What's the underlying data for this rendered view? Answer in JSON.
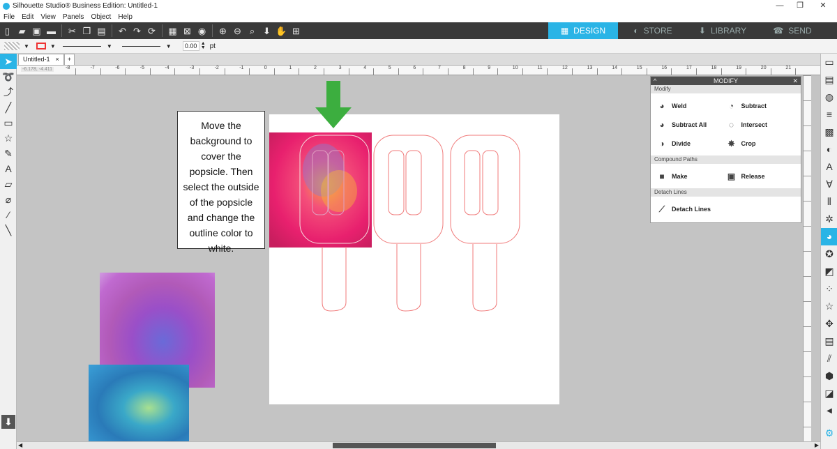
{
  "window": {
    "title": "Silhouette Studio® Business Edition: Untitled-1",
    "minimize": "—",
    "restore": "❐",
    "close": "✕"
  },
  "menu": [
    "File",
    "Edit",
    "View",
    "Panels",
    "Object",
    "Help"
  ],
  "main_tabs": [
    {
      "label": "DESIGN",
      "icon": "▦",
      "active": true
    },
    {
      "label": "STORE",
      "icon": "◐",
      "active": false
    },
    {
      "label": "LIBRARY",
      "icon": "⬇",
      "active": false
    },
    {
      "label": "SEND",
      "icon": "☎",
      "active": false
    }
  ],
  "propbar": {
    "line_width_value": "0.00",
    "line_width_unit": "pt"
  },
  "doc_tab": {
    "label": "Untitled-1",
    "close": "×",
    "add": "+"
  },
  "ruler": {
    "top_labels": [
      "-8",
      "-7",
      "-6",
      "-5",
      "-4",
      "-3",
      "-2",
      "-1",
      "0",
      "1",
      "2",
      "3",
      "4",
      "5",
      "6",
      "7",
      "8",
      "9",
      "10",
      "11",
      "12",
      "13",
      "14",
      "15",
      "16",
      "17",
      "18",
      "19",
      "20",
      "21"
    ],
    "cursor_readout": "-6.178, -4.411"
  },
  "note": {
    "text": "Move the background to cover the popsicle. Then select the outside of the popsicle and change the outline color to white."
  },
  "modify_panel": {
    "title": "MODIFY",
    "sections": {
      "modify": "Modify",
      "compound": "Compound Paths",
      "detach": "Detach Lines"
    },
    "items": {
      "weld": "Weld",
      "subtract": "Subtract",
      "subtract_all": "Subtract All",
      "intersect": "Intersect",
      "divide": "Divide",
      "crop": "Crop",
      "make": "Make",
      "release": "Release",
      "detach_lines": "Detach Lines"
    }
  },
  "colors": {
    "accent": "#2ab4e6",
    "toolbar": "#3a3a3a",
    "arrow": "#3cae3f",
    "popsicle_outline": "#f07a7a"
  },
  "icons": [
    "select-icon",
    "point-edit-icon",
    "line-icon",
    "rectangle-icon",
    "star-icon",
    "pencil-icon",
    "text-icon",
    "eraser-icon",
    "knife-icon",
    "eyedropper-icon"
  ]
}
